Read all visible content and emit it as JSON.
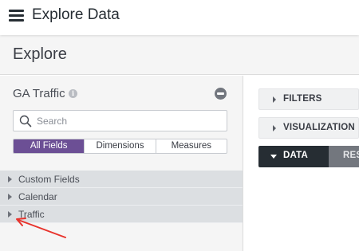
{
  "app": {
    "title": "Explore Data"
  },
  "page": {
    "title": "Explore"
  },
  "field_picker": {
    "explore_name": "GA Traffic",
    "info_icon": "info-icon",
    "collapse_icon": "minus-circle-icon",
    "search": {
      "placeholder": "Search",
      "value": ""
    },
    "filter_tabs": [
      {
        "label": "All Fields",
        "selected": true
      },
      {
        "label": "Dimensions",
        "selected": false
      },
      {
        "label": "Measures",
        "selected": false
      }
    ],
    "groups": [
      {
        "label": "Custom Fields"
      },
      {
        "label": "Calendar"
      },
      {
        "label": "Traffic"
      }
    ]
  },
  "sections": {
    "filters": "FILTERS",
    "visualization": "VISUALIZATION",
    "data": "DATA",
    "results_partial": "RES"
  },
  "colors": {
    "accent_purple": "#6c4f95",
    "data_tab_bg": "#262d33",
    "annotation_arrow": "#e8332c"
  }
}
